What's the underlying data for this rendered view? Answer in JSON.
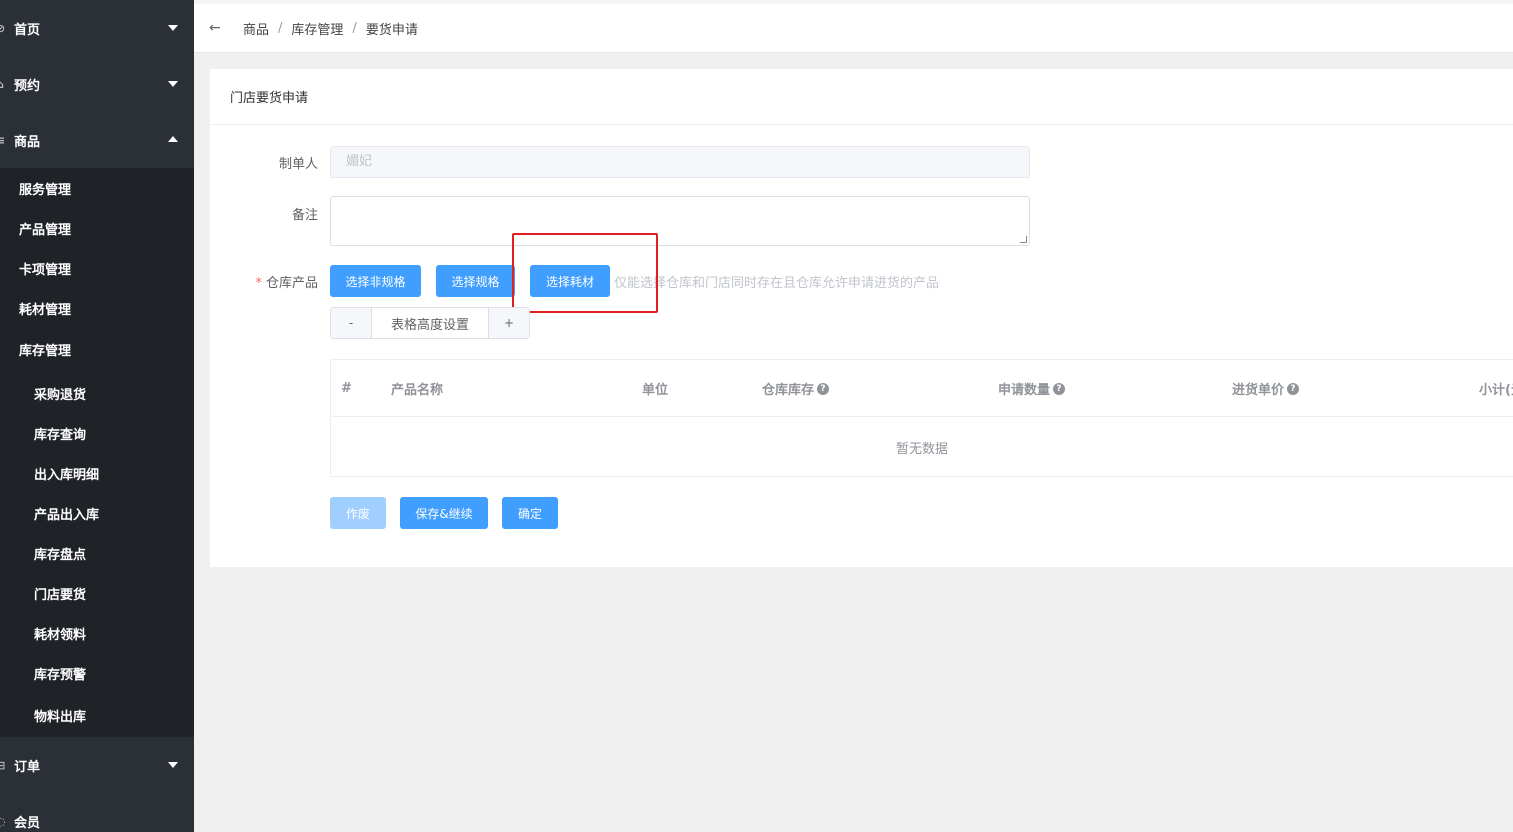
{
  "sidebar": {
    "menu": [
      {
        "label": "首页"
      },
      {
        "label": "预约"
      },
      {
        "label": "商品"
      }
    ],
    "goods_children": [
      "服务管理",
      "产品管理",
      "卡项管理",
      "耗材管理"
    ],
    "inventory": {
      "label": "库存管理",
      "children": [
        "采购退货",
        "库存查询",
        "出入库明细",
        "产品出入库",
        "库存盘点",
        "门店要货",
        "耗材领料",
        "库存预警",
        "物料出库"
      ]
    },
    "order": {
      "label": "订单"
    },
    "member": {
      "label": "会员"
    }
  },
  "breadcrumb": [
    "商品",
    "库存管理",
    "要货申请"
  ],
  "card": {
    "title": "门店要货申请",
    "maker_label": "制单人",
    "maker_value": "媚妃",
    "remark_label": "备注",
    "warehouse_label": "仓库产品",
    "btn_non_spec": "选择非规格",
    "btn_spec": "选择规格",
    "btn_consumable": "选择耗材",
    "hint": "仅能选择仓库和门店同时存在且仓库允许申请进货的产品",
    "stepper": {
      "minus": "-",
      "label": "表格高度设置",
      "plus": "+"
    },
    "table": {
      "headers": [
        "#",
        "产品名称",
        "单位",
        "仓库库存",
        "申请数量",
        "进货单价",
        "小计(元)"
      ],
      "empty": "暂无数据"
    },
    "btn_void": "作废",
    "btn_save_continue": "保存&继续",
    "btn_confirm": "确定"
  }
}
